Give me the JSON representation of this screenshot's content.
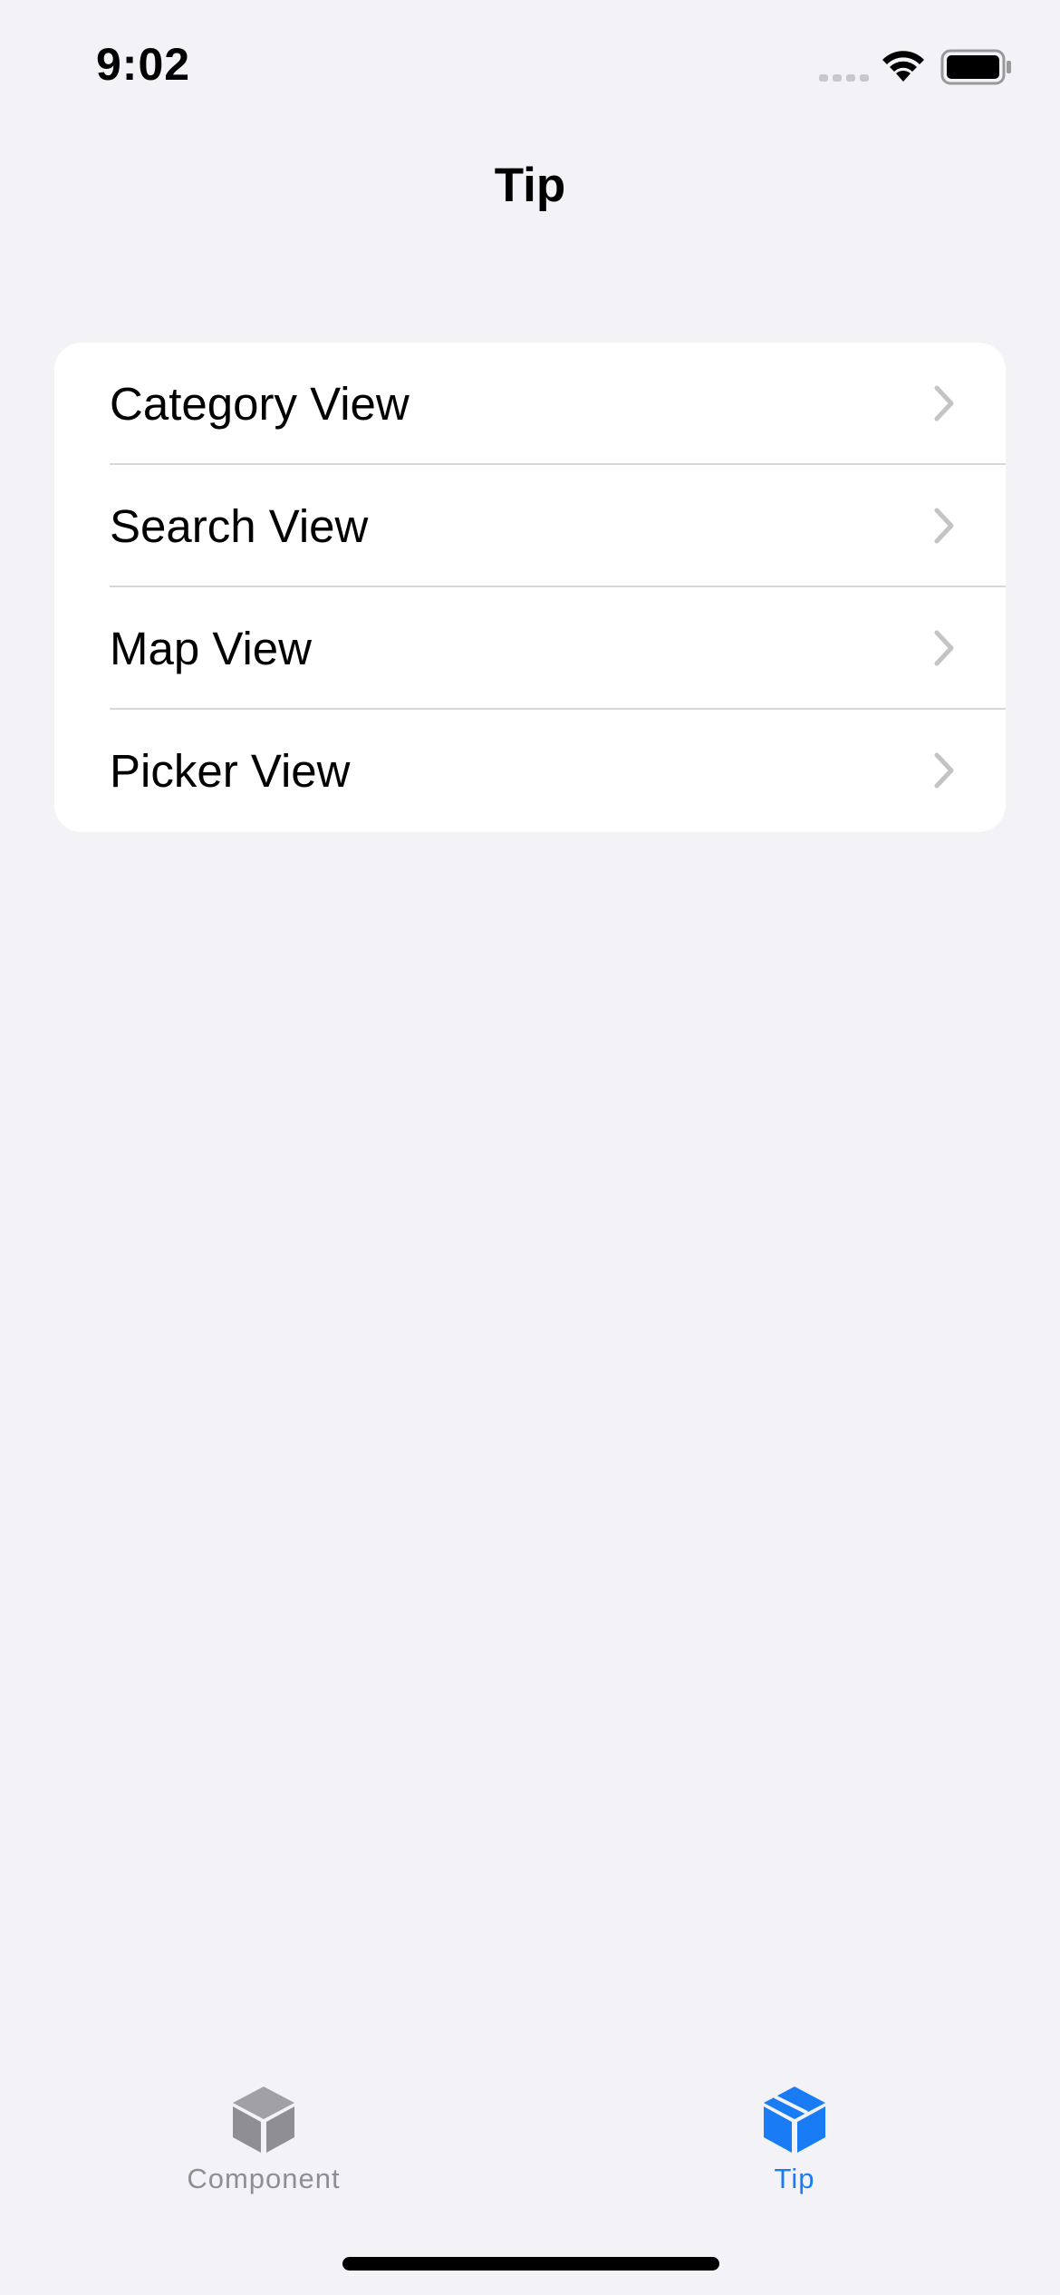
{
  "status_bar": {
    "time": "9:02",
    "icons": [
      "cellular-signal-icon",
      "wifi-icon",
      "battery-icon"
    ]
  },
  "nav": {
    "title": "Tip"
  },
  "list": {
    "items": [
      {
        "label": "Category View",
        "icon": "chevron-right-icon"
      },
      {
        "label": "Search View",
        "icon": "chevron-right-icon"
      },
      {
        "label": "Map View",
        "icon": "chevron-right-icon"
      },
      {
        "label": "Picker View",
        "icon": "chevron-right-icon"
      }
    ]
  },
  "tab_bar": {
    "tabs": [
      {
        "label": "Component",
        "icon": "cube-icon",
        "selected": false
      },
      {
        "label": "Tip",
        "icon": "cube-icon",
        "selected": true
      }
    ]
  },
  "colors": {
    "background": "#f2f2f7",
    "card": "#ffffff",
    "accent": "#1a7cf5",
    "inactive_tab": "#8e8e93",
    "chevron": "#c4c4c7",
    "separator": "#d8d8dc"
  }
}
